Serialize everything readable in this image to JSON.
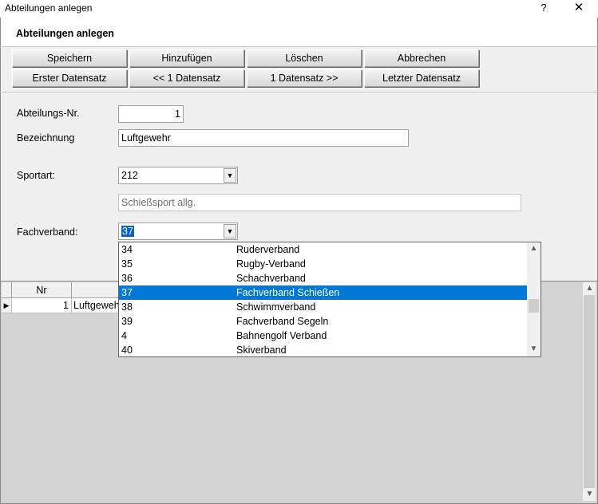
{
  "window": {
    "title": "Abteilungen anlegen",
    "help_label": "?",
    "close_label": "✕"
  },
  "form": {
    "heading": "Abteilungen anlegen"
  },
  "toolbar": {
    "save": "Speichern",
    "add": "Hinzufügen",
    "delete": "Löschen",
    "cancel": "Abbrechen",
    "first": "Erster Datensatz",
    "prev": "<< 1 Datensatz",
    "next": "1 Datensatz >>",
    "last": "Letzter Datensatz"
  },
  "fields": {
    "abteilungs_nr_label": "Abteilungs-Nr.",
    "abteilungs_nr_value": "1",
    "bezeichnung_label": "Bezeichnung",
    "bezeichnung_value": "Luftgewehr",
    "sportart_label": "Sportart:",
    "sportart_value": "212",
    "sportart_desc": "Schießsport allg.",
    "fachverband_label": "Fachverband:",
    "fachverband_value": "37"
  },
  "dropdown": {
    "items": [
      {
        "code": "34",
        "name": "Ruderverband"
      },
      {
        "code": "35",
        "name": "Rugby-Verband"
      },
      {
        "code": "36",
        "name": "Schachverband"
      },
      {
        "code": "37",
        "name": "Fachverband Schießen"
      },
      {
        "code": "38",
        "name": "Schwimmverband"
      },
      {
        "code": "39",
        "name": "Fachverband Segeln"
      },
      {
        "code": "4",
        "name": "Bahnengolf Verband"
      },
      {
        "code": "40",
        "name": "Skiverband"
      }
    ],
    "selected_index": 3
  },
  "grid": {
    "headers": [
      "Nr",
      ""
    ],
    "rows": [
      {
        "nr": "1",
        "bezeichnung": "Luftgeweh"
      }
    ]
  },
  "icons": {
    "row_indicator": "row-pointer-icon",
    "combo_arrow": "chevron-down-icon",
    "scroll_up": "scroll-up-icon",
    "scroll_down": "scroll-down-icon"
  },
  "colors": {
    "selection": "#0078d7",
    "toolbar_bg": "#f0f0f0"
  }
}
